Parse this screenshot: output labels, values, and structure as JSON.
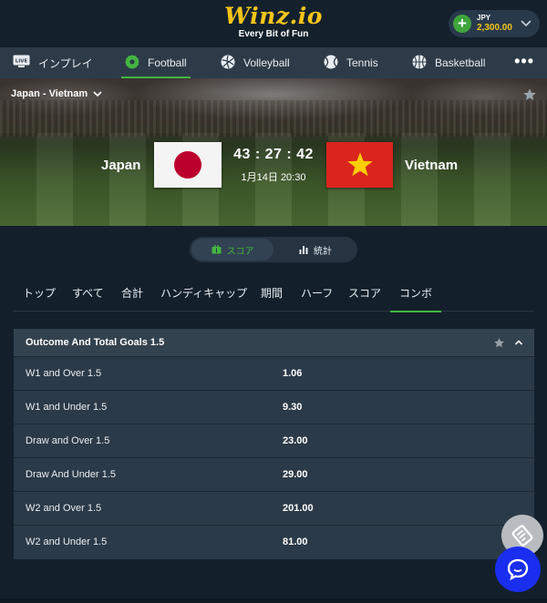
{
  "header": {
    "logo_text": "Winz.io",
    "logo_tagline": "Every Bit of Fun",
    "wallet": {
      "currency": "JPY",
      "balance": "2,300.00"
    }
  },
  "sports_nav": {
    "items": [
      {
        "label": "インプレイ",
        "icon": "live-icon",
        "active": false
      },
      {
        "label": "Football",
        "icon": "football-icon",
        "active": true
      },
      {
        "label": "Volleyball",
        "icon": "volleyball-icon",
        "active": false
      },
      {
        "label": "Tennis",
        "icon": "tennis-icon",
        "active": false
      },
      {
        "label": "Basketball",
        "icon": "basketball-icon",
        "active": false
      }
    ],
    "more": "•••"
  },
  "match": {
    "title": "Japan - Vietnam",
    "home_team": "Japan",
    "away_team": "Vietnam",
    "countdown": "43 : 27 : 42",
    "kickoff": "1月14日 20:30"
  },
  "view_toggle": {
    "score_label": "スコア",
    "stats_label": "統計",
    "active": "score"
  },
  "market_tabs": [
    "トップ",
    "すべて",
    "合計",
    "ハンディキャップ",
    "期間",
    "ハーフ",
    "スコア",
    "コンボ"
  ],
  "market_tabs_active": "コンボ",
  "market": {
    "title": "Outcome And Total Goals 1.5",
    "rows": [
      {
        "label": "W1 and Over 1.5",
        "odds": "1.06"
      },
      {
        "label": "W1 and Under 1.5",
        "odds": "9.30"
      },
      {
        "label": "Draw and Over 1.5",
        "odds": "23.00"
      },
      {
        "label": "Draw And Under 1.5",
        "odds": "29.00"
      },
      {
        "label": "W2 and Over 1.5",
        "odds": "201.00"
      },
      {
        "label": "W2 and Under 1.5",
        "odds": "81.00"
      }
    ]
  },
  "colors": {
    "brand_yellow": "#f5c518",
    "accent_green": "#43b540",
    "background": "#13202c",
    "chat_blue": "#1a2ef0"
  }
}
